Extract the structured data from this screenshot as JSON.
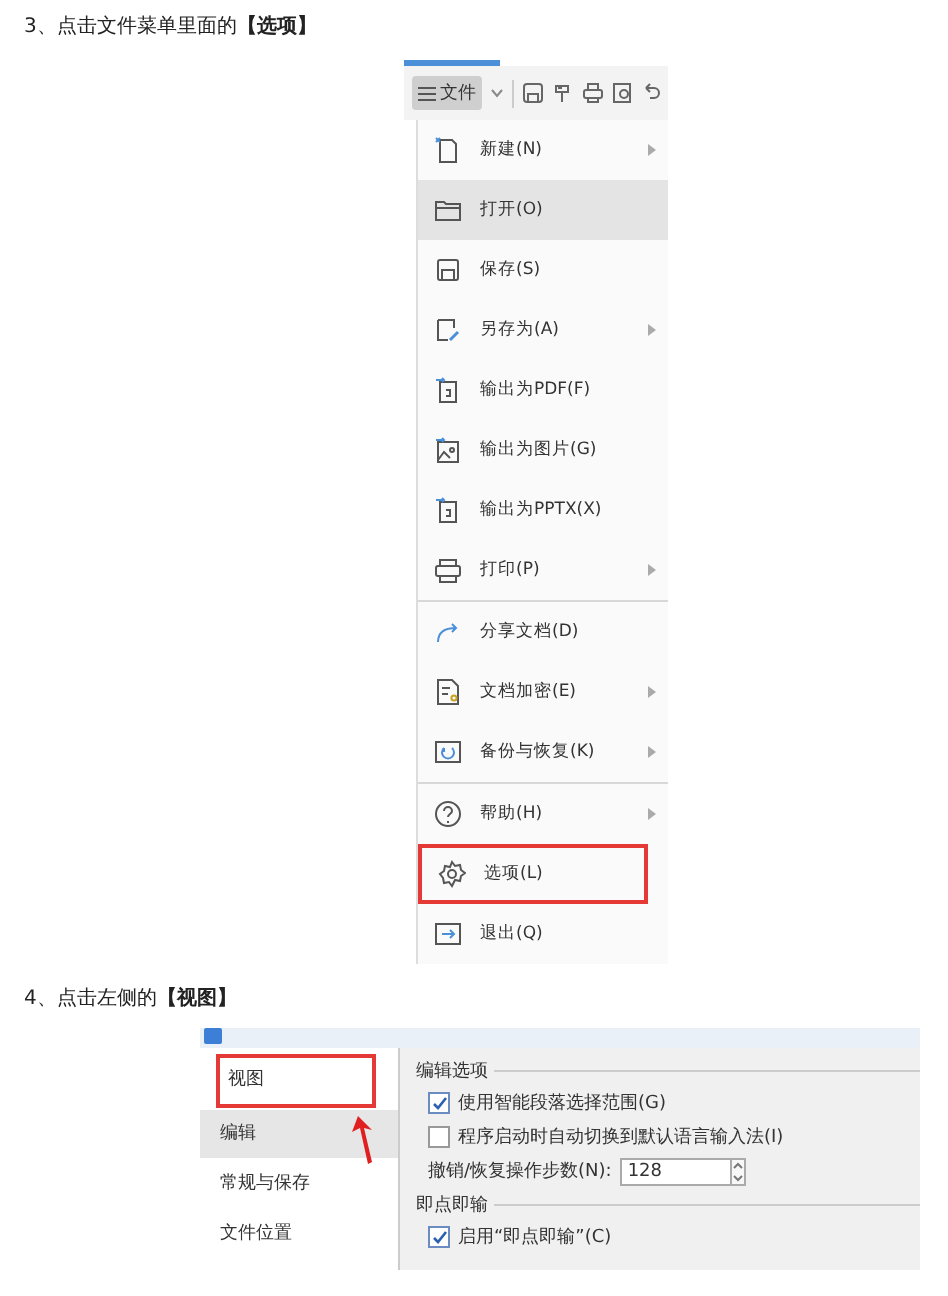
{
  "steps": [
    {
      "text": "3、点击文件菜单里面的**【选项】**"
    },
    {
      "text": "4、点击左侧的**【视图】**"
    }
  ],
  "file_menu": {
    "button": "文件",
    "items": [
      {
        "kind": "new",
        "label": "新建(N)",
        "submenu": true,
        "selected": false,
        "outlined": false,
        "divider_after": false
      },
      {
        "kind": "open",
        "label": "打开(O)",
        "submenu": false,
        "selected": true,
        "outlined": false,
        "divider_after": false
      },
      {
        "kind": "save",
        "label": "保存(S)",
        "submenu": false,
        "selected": false,
        "outlined": false,
        "divider_after": false
      },
      {
        "kind": "saveas",
        "label": "另存为(A)",
        "submenu": true,
        "selected": false,
        "outlined": false,
        "divider_after": false
      },
      {
        "kind": "pdf",
        "label": "输出为PDF(F)",
        "submenu": false,
        "selected": false,
        "outlined": false,
        "divider_after": false
      },
      {
        "kind": "image",
        "label": "输出为图片(G)",
        "submenu": false,
        "selected": false,
        "outlined": false,
        "divider_after": false
      },
      {
        "kind": "pptx",
        "label": "输出为PPTX(X)",
        "submenu": false,
        "selected": false,
        "outlined": false,
        "divider_after": false
      },
      {
        "kind": "print",
        "label": "打印(P)",
        "submenu": true,
        "selected": false,
        "outlined": false,
        "divider_after": true
      },
      {
        "kind": "share",
        "label": "分享文档(D)",
        "submenu": false,
        "selected": false,
        "outlined": false,
        "divider_after": false
      },
      {
        "kind": "encrypt",
        "label": "文档加密(E)",
        "submenu": true,
        "selected": false,
        "outlined": false,
        "divider_after": false
      },
      {
        "kind": "backup",
        "label": "备份与恢复(K)",
        "submenu": true,
        "selected": false,
        "outlined": false,
        "divider_after": true
      },
      {
        "kind": "help",
        "label": "帮助(H)",
        "submenu": true,
        "selected": false,
        "outlined": false,
        "divider_after": false
      },
      {
        "kind": "options",
        "label": "选项(L)",
        "submenu": false,
        "selected": false,
        "outlined": true,
        "divider_after": false
      },
      {
        "kind": "exit",
        "label": "退出(Q)",
        "submenu": false,
        "selected": false,
        "outlined": false,
        "divider_after": false
      }
    ]
  },
  "options_dialog": {
    "sidebar": [
      {
        "label": "视图",
        "selected": false,
        "outlined": true
      },
      {
        "label": "编辑",
        "selected": true,
        "outlined": false
      },
      {
        "label": "常规与保存",
        "selected": false,
        "outlined": false
      },
      {
        "label": "文件位置",
        "selected": false,
        "outlined": false
      }
    ],
    "sections": [
      {
        "title": "编辑选项",
        "rows": [
          {
            "kind": "checkbox",
            "label": "使用智能段落选择范围(G)",
            "checked": true
          },
          {
            "kind": "checkbox",
            "label": "程序启动时自动切换到默认语言输入法(I)",
            "checked": false
          },
          {
            "kind": "spinner",
            "label": "撤销/恢复操作步数(N):",
            "value": "128"
          }
        ]
      },
      {
        "title": "即点即输",
        "rows": [
          {
            "kind": "checkbox",
            "label": "启用“即点即输”(C)",
            "checked": true
          }
        ]
      }
    ]
  }
}
